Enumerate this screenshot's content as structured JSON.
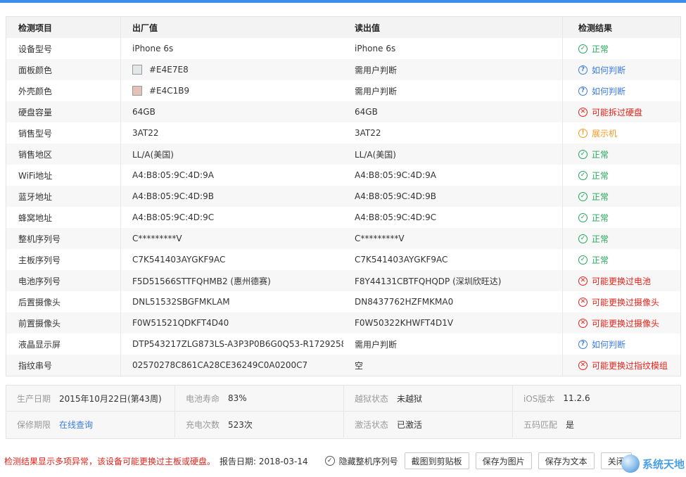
{
  "table": {
    "headers": [
      "检测项目",
      "出厂值",
      "读出值",
      "检测结果"
    ],
    "rows": [
      {
        "item": "设备型号",
        "factory": "iPhone 6s",
        "read": "iPhone 6s",
        "result": "正常",
        "status": "ok"
      },
      {
        "item": "面板颜色",
        "factory": "#E4E7E8",
        "swatch": "#E4E7E8",
        "read": "需用户判断",
        "result": "如何判断",
        "status": "info"
      },
      {
        "item": "外壳颜色",
        "factory": "#E4C1B9",
        "swatch": "#E4C1B9",
        "read": "需用户判断",
        "result": "如何判断",
        "status": "info"
      },
      {
        "item": "硬盘容量",
        "factory": "64GB",
        "read": "64GB",
        "result": "可能拆过硬盘",
        "status": "err"
      },
      {
        "item": "销售型号",
        "factory": "3AT22",
        "read": "3AT22",
        "result": "展示机",
        "status": "warn"
      },
      {
        "item": "销售地区",
        "factory": "LL/A(美国)",
        "read": "LL/A(美国)",
        "result": "正常",
        "status": "ok"
      },
      {
        "item": "WiFi地址",
        "factory": "A4:B8:05:9C:4D:9A",
        "read": "A4:B8:05:9C:4D:9A",
        "result": "正常",
        "status": "ok"
      },
      {
        "item": "蓝牙地址",
        "factory": "A4:B8:05:9C:4D:9B",
        "read": "A4:B8:05:9C:4D:9B",
        "result": "正常",
        "status": "ok"
      },
      {
        "item": "蜂窝地址",
        "factory": "A4:B8:05:9C:4D:9C",
        "read": "A4:B8:05:9C:4D:9C",
        "result": "正常",
        "status": "ok"
      },
      {
        "item": "整机序列号",
        "factory": "C*********V",
        "read": "C*********V",
        "result": "正常",
        "status": "ok"
      },
      {
        "item": "主板序列号",
        "factory": "C7K541403AYGKF9AC",
        "read": "C7K541403AYGKF9AC",
        "result": "正常",
        "status": "ok"
      },
      {
        "item": "电池序列号",
        "factory": "F5D51566STTFQHMB2 (惠州德赛)",
        "read": "F8Y44131CBTFQHQDP (深圳欣旺达)",
        "result": "可能更换过电池",
        "status": "err"
      },
      {
        "item": "后置摄像头",
        "factory": "DNL51532SBGFMKLAM",
        "read": "DN8437762HZFMKMA0",
        "result": "可能更换过摄像头",
        "status": "err"
      },
      {
        "item": "前置摄像头",
        "factory": "F0W51521QDKFT4D40",
        "read": "F0W50322KHWFT4D1V",
        "result": "可能更换过摄像头",
        "status": "err"
      },
      {
        "item": "液晶显示屏",
        "factory": "DTP543217ZLG873LS-A3P3P0B6G0Q53-R1729258...",
        "read": "需用户判断",
        "result": "如何判断",
        "status": "info"
      },
      {
        "item": "指纹串号",
        "factory": "02570278C861CA28CE36249C0A0200C7",
        "read": "空",
        "result": "可能更换过指纹模组",
        "status": "err"
      }
    ]
  },
  "info": [
    {
      "label": "生产日期",
      "value": "2015年10月22日(第43周)"
    },
    {
      "label": "电池寿命",
      "value": "83%"
    },
    {
      "label": "越狱状态",
      "value": "未越狱"
    },
    {
      "label": "iOS版本",
      "value": "11.2.6"
    },
    {
      "label": "保修期限",
      "value": "在线查询",
      "link": true
    },
    {
      "label": "充电次数",
      "value": "523次"
    },
    {
      "label": "激活状态",
      "value": "已激活"
    },
    {
      "label": "五码匹配",
      "value": "是"
    }
  ],
  "footer": {
    "warning": "检测结果显示多项异常，该设备可能更换过主板或硬盘。",
    "report_date": "报告日期: 2018-03-14",
    "hide_serial": "隐藏整机序列号",
    "btn_clipboard": "截图到剪贴板",
    "btn_save_image": "保存为图片",
    "btn_save_text": "保存为文本",
    "btn_close": "关闭"
  },
  "watermark": "系统天地",
  "icons": {
    "ok": "check-circle-icon",
    "info": "question-circle-icon",
    "err": "x-circle-icon",
    "warn": "exclamation-circle-icon"
  },
  "colors": {
    "ok": "#26a65b",
    "err": "#e2231a",
    "warn": "#f19a1f",
    "info": "#3b7ddd",
    "accent": "#3b8ee8"
  }
}
